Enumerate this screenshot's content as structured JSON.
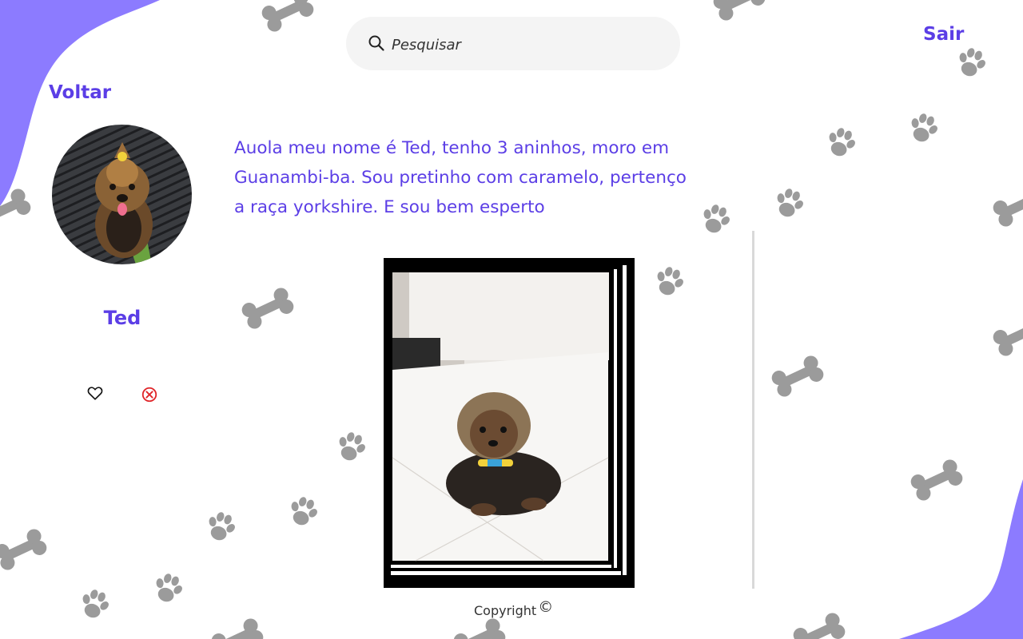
{
  "header": {
    "search": {
      "placeholder": "Pesquisar",
      "icon": "search-icon"
    },
    "logout_label": "Sair",
    "back_label": "Voltar"
  },
  "profile": {
    "name": "Ted",
    "bio": "Auola meu nome é Ted, tenho 3 aninhos, moro em Guanambi-ba.  Sou pretinho com caramelo, pertenço a raça yorkshire. E sou bem esperto",
    "actions": {
      "like_icon": "heart-icon",
      "remove_icon": "close-circle-icon"
    }
  },
  "footer": {
    "copyright": "Copyright",
    "symbol": "©"
  },
  "colors": {
    "accent": "#5b3ee6",
    "blob": "#8c7bff",
    "decoration": "#9b9b9b",
    "remove": "#e0262a"
  }
}
